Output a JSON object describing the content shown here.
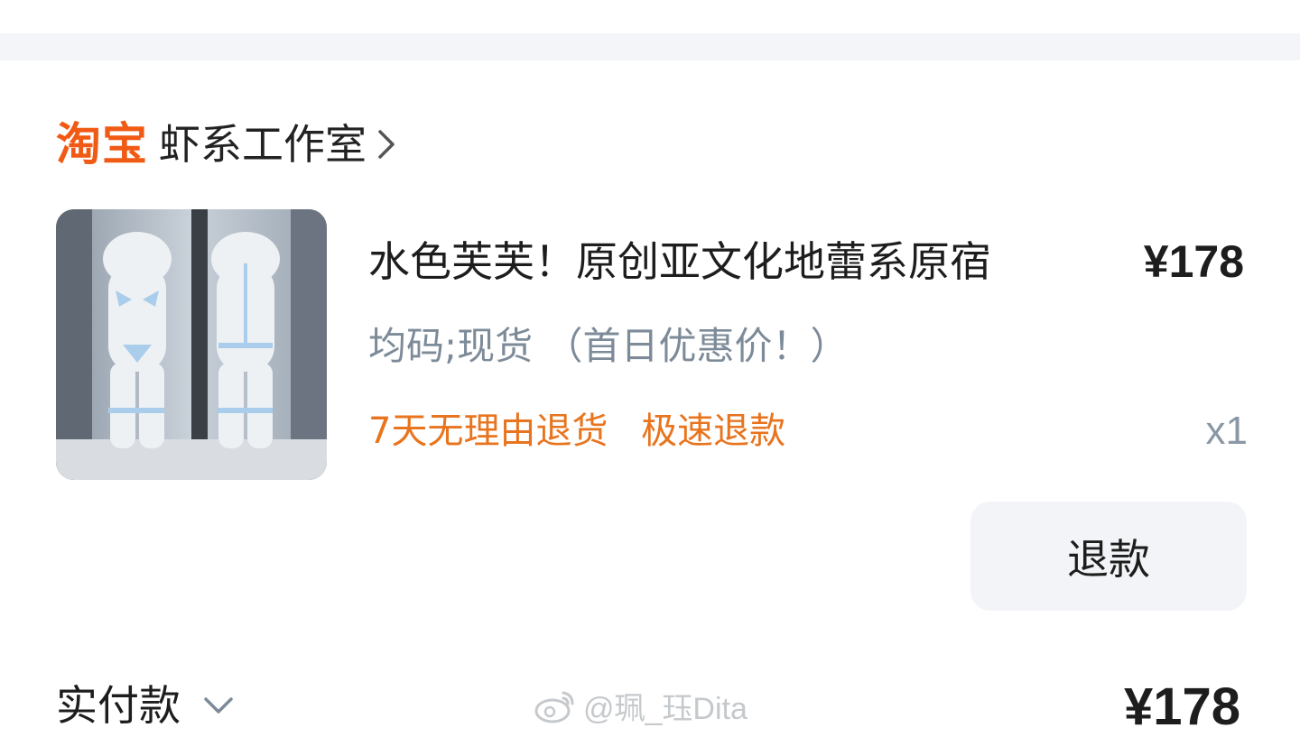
{
  "shop": {
    "platform_logo": "淘宝",
    "name": "虾系工作室",
    "chevron_icon": "chevron-right-icon"
  },
  "product": {
    "thumbnail_icon": "product-image",
    "title": "水色芙芙！原创亚文化地蕾系原宿",
    "price": "¥178",
    "sku": "均码;现货 （首日优惠价！）",
    "services": [
      "7天无理由退货",
      "极速退款"
    ],
    "quantity": "x1"
  },
  "actions": {
    "refund_label": "退款"
  },
  "summary": {
    "paid_label": "实付款",
    "paid_amount": "¥178",
    "chevron_icon": "chevron-down-icon"
  },
  "watermark": {
    "text": "@珮_珏Dita",
    "icon": "weibo-icon"
  },
  "colors": {
    "brand_orange": "#f05a14",
    "service_orange": "#e8741e",
    "muted_text": "#7d8b99",
    "band_bg": "#f3f5f8",
    "button_bg": "#f2f4f7"
  }
}
